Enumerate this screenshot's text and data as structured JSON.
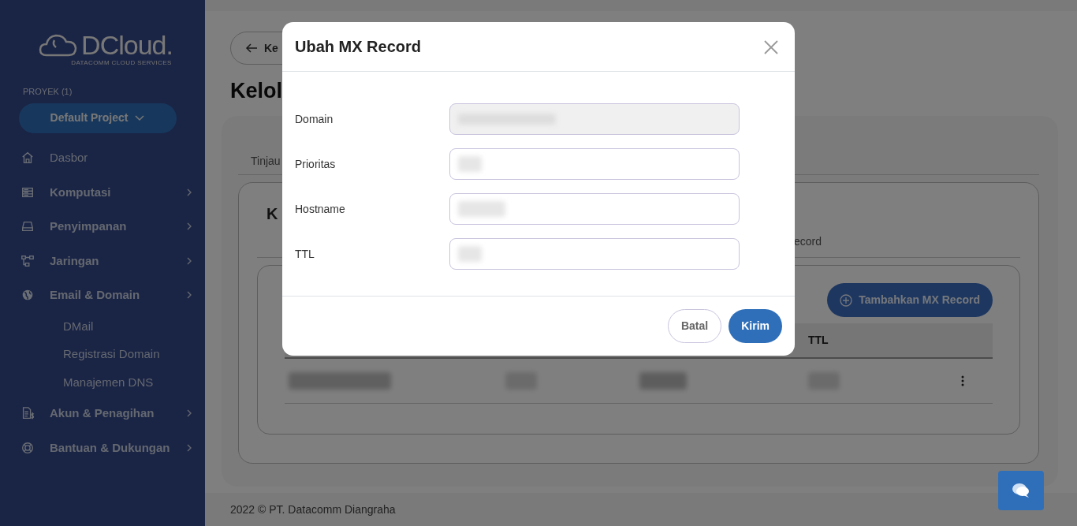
{
  "sidebar": {
    "logo": {
      "name": "DCloud.",
      "tagline": "DATACOMM CLOUD SERVICES"
    },
    "project_label": "PROYEK (1)",
    "project": "Default Project",
    "items": [
      {
        "label": "Dasbor",
        "expandable": false
      },
      {
        "label": "Komputasi",
        "expandable": true
      },
      {
        "label": "Penyimpanan",
        "expandable": true
      },
      {
        "label": "Jaringan",
        "expandable": true
      },
      {
        "label": "Email & Domain",
        "expandable": true,
        "expanded": true,
        "children": [
          {
            "label": "DMail"
          },
          {
            "label": "Registrasi Domain"
          },
          {
            "label": "Manajemen DNS"
          }
        ]
      },
      {
        "label": "Akun & Penagihan",
        "expandable": true
      },
      {
        "label": "Bantuan & Dukungan",
        "expandable": true
      }
    ]
  },
  "back_button": "Ke",
  "heading": "Kelol",
  "tabs": [
    {
      "label": "Tinjau"
    }
  ],
  "panel": {
    "heading": "K",
    "subtabs": [
      {
        "label": "ecord"
      }
    ],
    "add_button": "Tambahkan MX Record",
    "table": {
      "columns": [
        "TTL"
      ]
    }
  },
  "footer": "2022 © PT. Datacomm Diangraha",
  "modal": {
    "title": "Ubah MX Record",
    "fields": [
      {
        "label": "Domain",
        "disabled": true
      },
      {
        "label": "Prioritas",
        "disabled": false
      },
      {
        "label": "Hostname",
        "disabled": false
      },
      {
        "label": "TTL",
        "disabled": false
      }
    ],
    "buttons": [
      {
        "label": "Batal",
        "kind": "secondary"
      },
      {
        "label": "Kirim",
        "kind": "primary"
      }
    ]
  }
}
